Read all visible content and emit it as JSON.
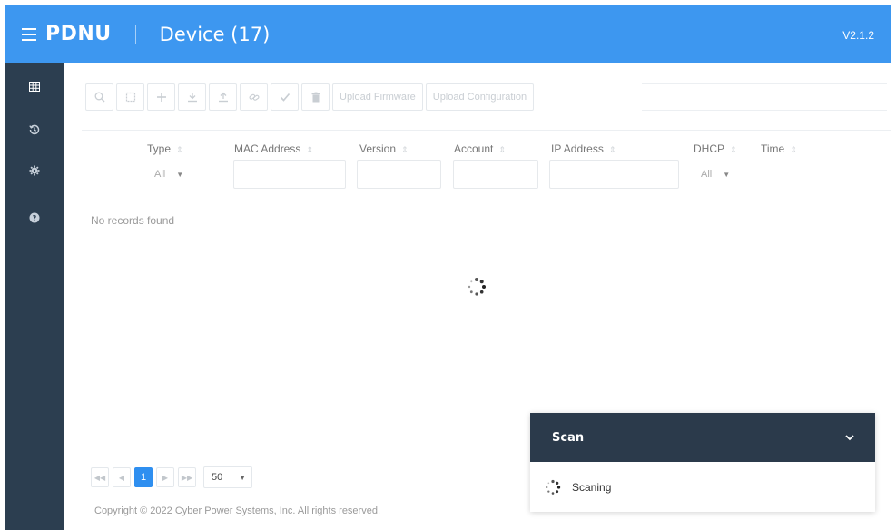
{
  "header": {
    "brand": "PDNU",
    "title": "Device (17)",
    "version": "V2.1.2"
  },
  "sidebar": {
    "items": [
      {
        "icon": "grid-icon"
      },
      {
        "icon": "history-icon"
      },
      {
        "icon": "gear-icon"
      },
      {
        "icon": "help-icon"
      }
    ]
  },
  "toolbar": {
    "icons": [
      "search-icon",
      "select-all-icon",
      "add-icon",
      "download-icon",
      "upload-icon",
      "link-icon",
      "check-icon",
      "delete-icon"
    ],
    "upload_firmware_label": "Upload Firmware",
    "upload_configuration_label": "Upload Configuration"
  },
  "table": {
    "columns": {
      "type": "Type",
      "mac": "MAC Address",
      "version": "Version",
      "account": "Account",
      "ip": "IP Address",
      "dhcp": "DHCP",
      "time": "Time"
    },
    "type_filter_value": "All",
    "dhcp_filter_value": "All",
    "empty_text": "No records found"
  },
  "pagination": {
    "current_page": "1",
    "page_size": "50"
  },
  "footer": {
    "copyright": "Copyright © 2022 Cyber Power Systems, Inc. All rights reserved."
  },
  "scan": {
    "title": "Scan",
    "status": "Scaning"
  },
  "colors": {
    "header": "#3d97f0",
    "sidebar": "#2c3e50",
    "scan_header": "#2b3a4b",
    "accent": "#2f8ff0"
  }
}
